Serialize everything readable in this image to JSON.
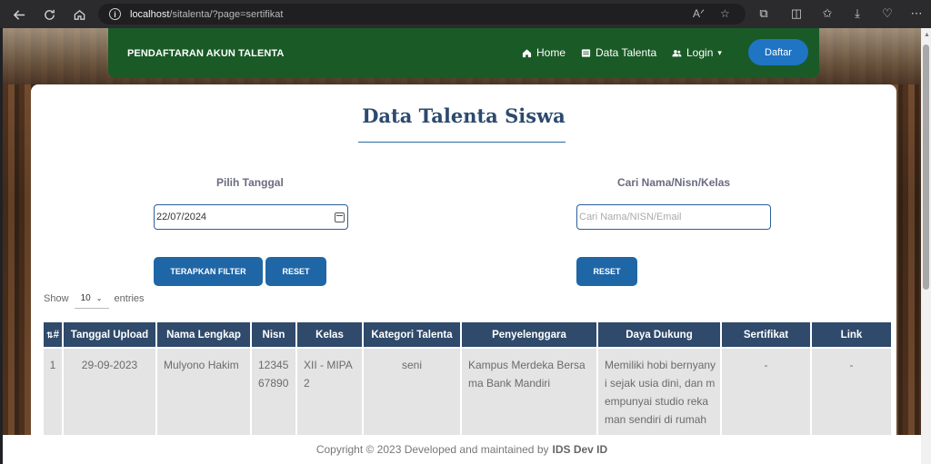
{
  "browser": {
    "url_host": "localhost",
    "url_path": "/sitalenta/?page=sertifikat"
  },
  "navbar": {
    "brand": "PENDAFTARAN AKUN TALENTA",
    "home": "Home",
    "data_talenta": "Data Talenta",
    "login": "Login",
    "daftar": "Daftar"
  },
  "main": {
    "title": "Data Talenta Siswa",
    "date_label": "Pilih Tanggal",
    "date_value": "22/07/2024",
    "apply_btn": "TERAPKAN FILTER",
    "reset_btn": "RESET",
    "search_label": "Cari Nama/Nisn/Kelas",
    "search_placeholder": "Cari Nama/NISN/Email",
    "search_reset_btn": "RESET",
    "show_label": "Show",
    "entries_value": "10",
    "entries_label": "entries"
  },
  "table": {
    "headers": [
      "#",
      "Tanggal Upload",
      "Nama Lengkap",
      "Nisn",
      "Kelas",
      "Kategori Talenta",
      "Penyelenggara",
      "Daya Dukung",
      "Sertifikat",
      "Link"
    ],
    "rows": [
      {
        "no": "1",
        "tanggal": "29-09-2023",
        "nama": "Mulyono Hakim",
        "nisn": "1234567890",
        "kelas": "XII - MIPA 2",
        "kategori": "seni",
        "penyelenggara": "Kampus Merdeka Bersama Bank Mandiri",
        "daya_dukung": "Memiliki hobi bernyanyi sejak usia dini, dan mempunyai studio rekaman sendiri di rumah",
        "sertifikat": "-",
        "link": "-"
      }
    ]
  },
  "footer": {
    "text": "Copyright © 2023 Developed and maintained by",
    "author": "IDS Dev ID"
  }
}
